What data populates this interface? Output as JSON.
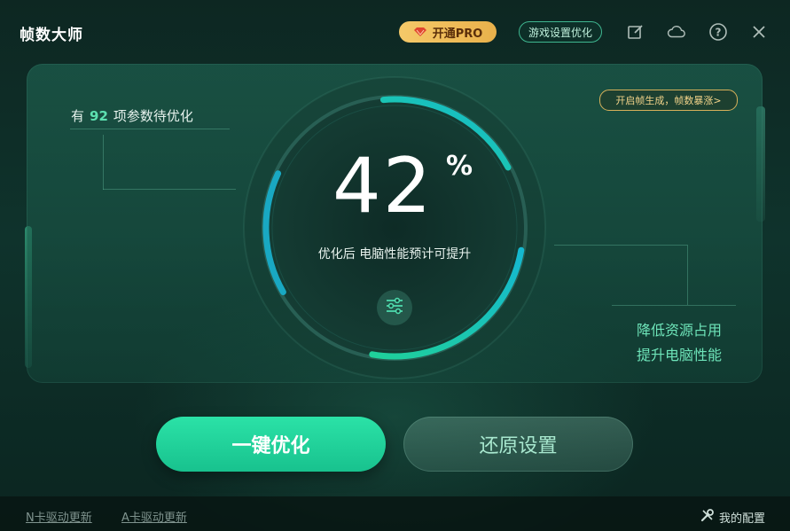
{
  "app": {
    "title": "帧数大师"
  },
  "header": {
    "pro_label": "开通PRO",
    "game_settings_label": "游戏设置优化",
    "icons": [
      "edit-icon",
      "cloud-icon",
      "help-icon",
      "close-icon"
    ]
  },
  "main": {
    "params_prefix": "有",
    "params_count": "92",
    "params_suffix": "项参数待优化",
    "promo_label": "开启帧生成，帧数暴涨>",
    "percent_value": "42",
    "percent_sign": "%",
    "progress_fraction": 0.42,
    "subtitle": "优化后 电脑性能预计可提升",
    "benefit_line1": "降低资源占用",
    "benefit_line2": "提升电脑性能"
  },
  "actions": {
    "optimize_label": "一键优化",
    "restore_label": "还原设置"
  },
  "footer": {
    "n_card_driver": "N卡驱动更新",
    "a_card_driver": "A卡驱动更新",
    "my_config": "我的配置"
  },
  "colors": {
    "accent": "#1fd09a",
    "accent_cyan": "#16b7cf",
    "pro_gold": "#f0bf5b",
    "background": "#0f332c"
  }
}
